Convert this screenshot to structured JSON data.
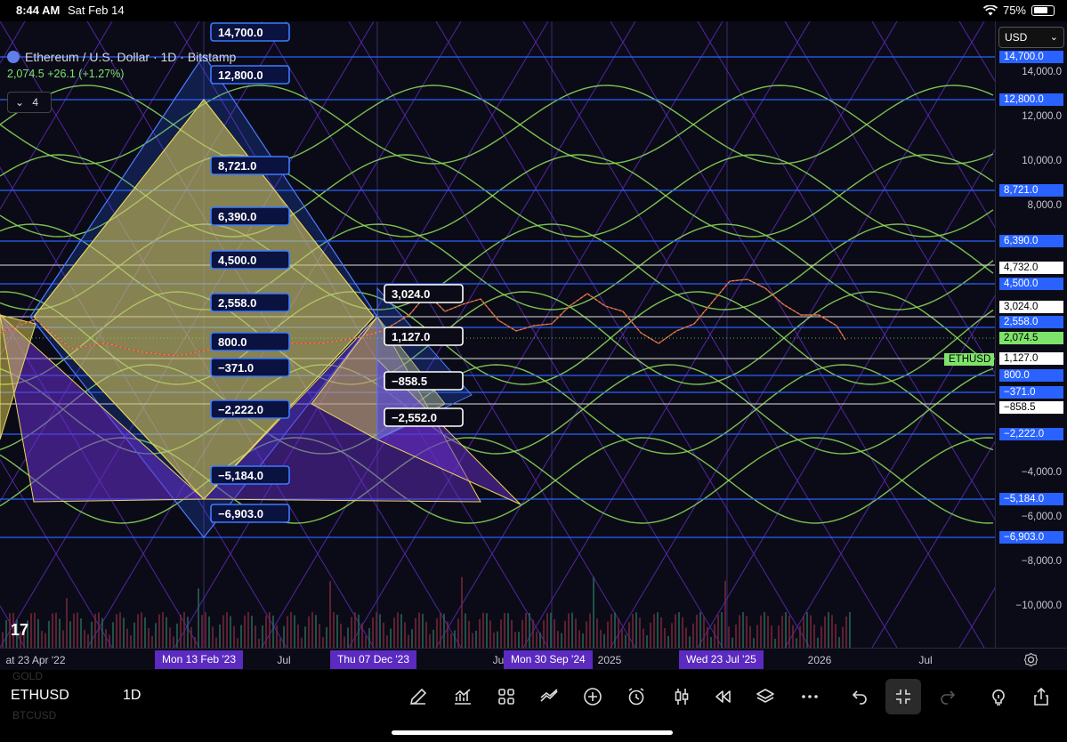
{
  "status_bar": {
    "time": "8:44 AM",
    "date": "Sat Feb 14",
    "battery": "75%",
    "battery_level": 0.75
  },
  "legend": {
    "title": "Ethereum / U.S. Dollar · 1D · Bitstamp",
    "price": "2,074.5",
    "change": "+26.1 (+1.27%)",
    "indicator_count": "4"
  },
  "currency": "USD",
  "price_axis": {
    "ticks": [
      "14,000.0",
      "12,000.0",
      "10,000.0",
      "8,000.0",
      "−4,000.0",
      "−6,000.0",
      "−8,000.0",
      "−10,000.0"
    ],
    "tags": [
      {
        "label": "14,700.0",
        "bg": "#2962ff",
        "fg": "#ffffff"
      },
      {
        "label": "12,800.0",
        "bg": "#2962ff",
        "fg": "#ffffff"
      },
      {
        "label": "8,721.0",
        "bg": "#2962ff",
        "fg": "#ffffff"
      },
      {
        "label": "6,390.0",
        "bg": "#2962ff",
        "fg": "#ffffff"
      },
      {
        "label": "4,732.0",
        "bg": "#ffffff",
        "fg": "#000000"
      },
      {
        "label": "4,500.0",
        "bg": "#2962ff",
        "fg": "#ffffff"
      },
      {
        "label": "3,024.0",
        "bg": "#ffffff",
        "fg": "#000000"
      },
      {
        "label": "2,558.0",
        "bg": "#2962ff",
        "fg": "#ffffff"
      },
      {
        "label": "2,074.5",
        "bg": "#7ee36a",
        "fg": "#000000"
      },
      {
        "label": "1,127.0",
        "bg": "#ffffff",
        "fg": "#000000"
      },
      {
        "label": "800.0",
        "bg": "#2962ff",
        "fg": "#ffffff"
      },
      {
        "label": "−371.0",
        "bg": "#2962ff",
        "fg": "#ffffff"
      },
      {
        "label": "−858.5",
        "bg": "#ffffff",
        "fg": "#000000"
      },
      {
        "label": "−2,222.0",
        "bg": "#2962ff",
        "fg": "#ffffff"
      },
      {
        "label": "−5,184.0",
        "bg": "#2962ff",
        "fg": "#ffffff"
      },
      {
        "label": "−6,903.0",
        "bg": "#2962ff",
        "fg": "#ffffff"
      }
    ],
    "symbol_tag": "ETHUSD"
  },
  "chart_labels": {
    "blue": [
      "14,700.0",
      "12,800.0",
      "8,721.0",
      "6,390.0",
      "4,500.0",
      "2,558.0",
      "800.0",
      "−371.0",
      "−2,222.0",
      "−5,184.0",
      "−6,903.0"
    ],
    "white": [
      "3,024.0",
      "1,127.0",
      "−858.5",
      "−2,552.0"
    ]
  },
  "time_axis": {
    "ticks": [
      "at 23 Apr '22",
      "Jul",
      "Ju",
      "2025",
      "2026",
      "Jul"
    ],
    "highlights": [
      "Mon 13 Feb '23",
      "Thu 07 Dec '23",
      "Mon 30 Sep '24",
      "Wed 23 Jul '25"
    ]
  },
  "toolbar": {
    "symbol": "ETHUSD",
    "timeframe": "1D",
    "ghost_top": "GOLD",
    "ghost_bottom": "BTCUSD"
  },
  "colors": {
    "background": "#0b0b17",
    "blue": "#2962ff",
    "purple": "#6a2fd0",
    "yellow": "#e8d65a",
    "green": "#8ee05a"
  }
}
